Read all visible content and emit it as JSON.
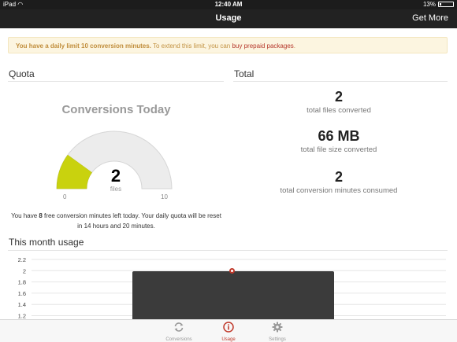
{
  "status_bar": {
    "device": "iPad",
    "time": "12:40 AM",
    "battery": "13%",
    "battery_level": 0.13
  },
  "nav": {
    "title": "Usage",
    "right_button": "Get More"
  },
  "alert": {
    "bold": "You have a daily limit 10 conversion minutes.",
    "text": " To extend this limit, you can ",
    "link": "buy prepaid packages",
    "end": "."
  },
  "quota": {
    "section_title": "Quota",
    "gauge_title": "Conversions Today",
    "value": "2",
    "unit": "files",
    "min": "0",
    "max": "10",
    "fill_fraction": 0.2,
    "line1_pre": "You have ",
    "line1_bold": "8",
    "line1_post": " free conversion minutes left today. Your daily quota will be reset",
    "line2": "in 14 hours and 20 minutes.",
    "colors": {
      "fill": "#c9d20e",
      "track": "#ececec"
    }
  },
  "total": {
    "section_title": "Total",
    "items": [
      {
        "value": "2",
        "label": "total files converted"
      },
      {
        "value": "66 MB",
        "label": "total file size converted"
      },
      {
        "value": "2",
        "label": "total conversion minutes consumed"
      }
    ]
  },
  "month": {
    "section_title": "This month usage",
    "chart_data": {
      "type": "line",
      "y_ticks": [
        "2.2",
        "2",
        "1.8",
        "1.6",
        "1.4",
        "1.2"
      ],
      "ylim": [
        1.2,
        2.2
      ],
      "grid": true
    }
  },
  "tabs": [
    {
      "label": "Conversions",
      "icon": "refresh-icon",
      "active": false
    },
    {
      "label": "Usage",
      "icon": "info-icon",
      "active": true
    },
    {
      "label": "Settings",
      "icon": "gear-icon",
      "active": false
    }
  ],
  "accent": "#c0392b"
}
